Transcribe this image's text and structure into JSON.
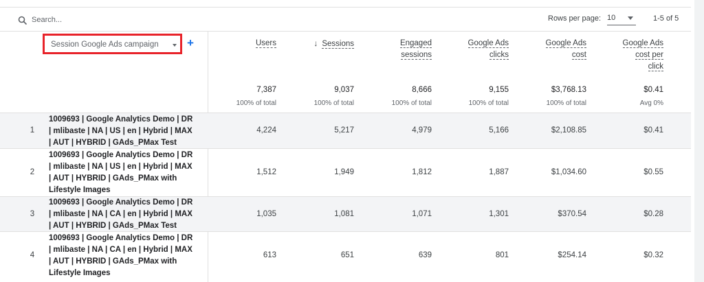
{
  "search": {
    "placeholder": "Search..."
  },
  "pagination": {
    "rows_label": "Rows per page:",
    "rows_value": "10",
    "range": "1-5 of 5"
  },
  "dimension": {
    "label": "Session Google Ads campaign",
    "add_symbol": "+"
  },
  "columns": [
    {
      "id": "users",
      "lines": [
        "Users"
      ]
    },
    {
      "id": "sessions",
      "lines": [
        "Sessions"
      ],
      "sort_arrow": "↓"
    },
    {
      "id": "engaged",
      "lines": [
        "Engaged",
        "sessions"
      ]
    },
    {
      "id": "clicks",
      "lines": [
        "Google Ads",
        "clicks"
      ]
    },
    {
      "id": "cost",
      "lines": [
        "Google Ads",
        "cost"
      ]
    },
    {
      "id": "cpc",
      "lines": [
        "Google Ads",
        "cost per",
        "click"
      ]
    }
  ],
  "totals": [
    {
      "value": "7,387",
      "sub": "100% of total"
    },
    {
      "value": "9,037",
      "sub": "100% of total"
    },
    {
      "value": "8,666",
      "sub": "100% of total"
    },
    {
      "value": "9,155",
      "sub": "100% of total"
    },
    {
      "value": "$3,768.13",
      "sub": "100% of total"
    },
    {
      "value": "$0.41",
      "sub": "Avg 0%"
    }
  ],
  "rows": [
    {
      "num": "1",
      "name_lines": [
        "1009693 | Google Analytics Demo | DR",
        "| mlibaste | NA | US | en | Hybrid | MAX",
        "| AUT | HYBRID | GAds_PMax Test"
      ],
      "values": [
        "4,224",
        "5,217",
        "4,979",
        "5,166",
        "$2,108.85",
        "$0.41"
      ]
    },
    {
      "num": "2",
      "name_lines": [
        "1009693 | Google Analytics Demo | DR",
        "| mlibaste | NA | US | en | Hybrid | MAX",
        "| AUT | HYBRID | GAds_PMax with",
        "Lifestyle Images"
      ],
      "values": [
        "1,512",
        "1,949",
        "1,812",
        "1,887",
        "$1,034.60",
        "$0.55"
      ]
    },
    {
      "num": "3",
      "name_lines": [
        "1009693 | Google Analytics Demo | DR",
        "| mlibaste | NA | CA | en | Hybrid | MAX",
        "| AUT | HYBRID | GAds_PMax Test"
      ],
      "values": [
        "1,035",
        "1,081",
        "1,071",
        "1,301",
        "$370.54",
        "$0.28"
      ]
    },
    {
      "num": "4",
      "name_lines": [
        "1009693 | Google Analytics Demo | DR",
        "| mlibaste | NA | CA | en | Hybrid | MAX",
        "| AUT | HYBRID | GAds_PMax with",
        "Lifestyle Images"
      ],
      "values": [
        "613",
        "651",
        "639",
        "801",
        "$254.14",
        "$0.32"
      ]
    }
  ]
}
